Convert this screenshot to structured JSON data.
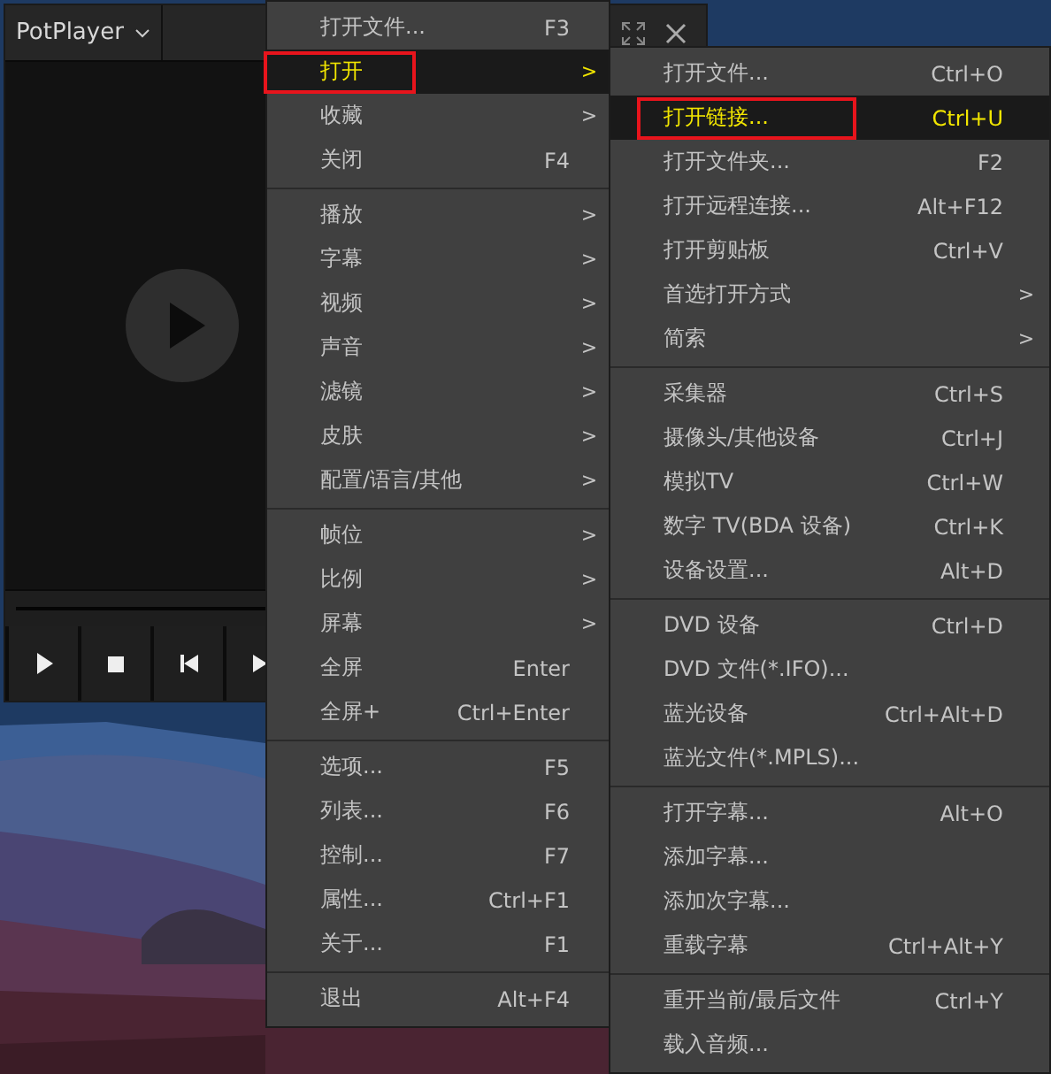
{
  "player": {
    "title": "PotPlayer"
  },
  "menus": [
    {
      "groups": [
        [
          {
            "label": "打开文件...",
            "shortcut": "F3",
            "selected": false,
            "annotated": false
          },
          {
            "label": "打开",
            "arrow": ">",
            "selected": true,
            "annotated": true
          },
          {
            "label": "收藏",
            "arrow": ">",
            "selected": false,
            "annotated": false
          },
          {
            "label": "关闭",
            "shortcut": "F4",
            "selected": false,
            "annotated": false
          }
        ],
        [
          {
            "label": "播放",
            "arrow": ">",
            "selected": false,
            "annotated": false
          },
          {
            "label": "字幕",
            "arrow": ">",
            "selected": false,
            "annotated": false
          },
          {
            "label": "视频",
            "arrow": ">",
            "selected": false,
            "annotated": false
          },
          {
            "label": "声音",
            "arrow": ">",
            "selected": false,
            "annotated": false
          },
          {
            "label": "滤镜",
            "arrow": ">",
            "selected": false,
            "annotated": false
          },
          {
            "label": "皮肤",
            "arrow": ">",
            "selected": false,
            "annotated": false
          },
          {
            "label": "配置/语言/其他",
            "arrow": ">",
            "selected": false,
            "annotated": false
          }
        ],
        [
          {
            "label": "帧位",
            "arrow": ">",
            "selected": false,
            "annotated": false
          },
          {
            "label": "比例",
            "arrow": ">",
            "selected": false,
            "annotated": false
          },
          {
            "label": "屏幕",
            "arrow": ">",
            "selected": false,
            "annotated": false
          },
          {
            "label": "全屏",
            "shortcut": "Enter",
            "selected": false,
            "annotated": false
          },
          {
            "label": "全屏+",
            "shortcut": "Ctrl+Enter",
            "selected": false,
            "annotated": false
          }
        ],
        [
          {
            "label": "选项...",
            "shortcut": "F5",
            "selected": false,
            "annotated": false
          },
          {
            "label": "列表...",
            "shortcut": "F6",
            "selected": false,
            "annotated": false
          },
          {
            "label": "控制...",
            "shortcut": "F7",
            "selected": false,
            "annotated": false
          },
          {
            "label": "属性...",
            "shortcut": "Ctrl+F1",
            "selected": false,
            "annotated": false
          },
          {
            "label": "关于...",
            "shortcut": "F1",
            "selected": false,
            "annotated": false
          }
        ],
        [
          {
            "label": "退出",
            "shortcut": "Alt+F4",
            "selected": false,
            "annotated": false
          }
        ]
      ]
    },
    {
      "groups": [
        [
          {
            "label": "打开文件...",
            "shortcut": "Ctrl+O",
            "selected": false,
            "annotated": false
          },
          {
            "label": "打开链接...",
            "shortcut": "Ctrl+U",
            "selected": true,
            "annotated": true
          },
          {
            "label": "打开文件夹...",
            "shortcut": "F2",
            "selected": false,
            "annotated": false
          },
          {
            "label": "打开远程连接...",
            "shortcut": "Alt+F12",
            "selected": false,
            "annotated": false
          },
          {
            "label": "打开剪贴板",
            "shortcut": "Ctrl+V",
            "selected": false,
            "annotated": false
          },
          {
            "label": "首选打开方式",
            "arrow": ">",
            "selected": false,
            "annotated": false
          },
          {
            "label": "简索",
            "arrow": ">",
            "selected": false,
            "annotated": false
          }
        ],
        [
          {
            "label": "采集器",
            "shortcut": "Ctrl+S",
            "selected": false,
            "annotated": false
          },
          {
            "label": "摄像头/其他设备",
            "shortcut": "Ctrl+J",
            "selected": false,
            "annotated": false
          },
          {
            "label": "模拟TV",
            "shortcut": "Ctrl+W",
            "selected": false,
            "annotated": false
          },
          {
            "label": "数字 TV(BDA 设备)",
            "shortcut": "Ctrl+K",
            "selected": false,
            "annotated": false
          },
          {
            "label": "设备设置...",
            "shortcut": "Alt+D",
            "selected": false,
            "annotated": false
          }
        ],
        [
          {
            "label": "DVD 设备",
            "shortcut": "Ctrl+D",
            "selected": false,
            "annotated": false
          },
          {
            "label": "DVD 文件(*.IFO)...",
            "selected": false,
            "annotated": false
          },
          {
            "label": "蓝光设备",
            "shortcut": "Ctrl+Alt+D",
            "selected": false,
            "annotated": false
          },
          {
            "label": "蓝光文件(*.MPLS)...",
            "selected": false,
            "annotated": false
          }
        ],
        [
          {
            "label": "打开字幕...",
            "shortcut": "Alt+O",
            "selected": false,
            "annotated": false
          },
          {
            "label": "添加字幕...",
            "selected": false,
            "annotated": false
          },
          {
            "label": "添加次字幕...",
            "selected": false,
            "annotated": false
          },
          {
            "label": "重载字幕",
            "shortcut": "Ctrl+Alt+Y",
            "selected": false,
            "annotated": false
          }
        ],
        [
          {
            "label": "重开当前/最后文件",
            "shortcut": "Ctrl+Y",
            "selected": false,
            "annotated": false
          },
          {
            "label": "载入音频...",
            "selected": false,
            "annotated": false
          }
        ]
      ]
    }
  ]
}
